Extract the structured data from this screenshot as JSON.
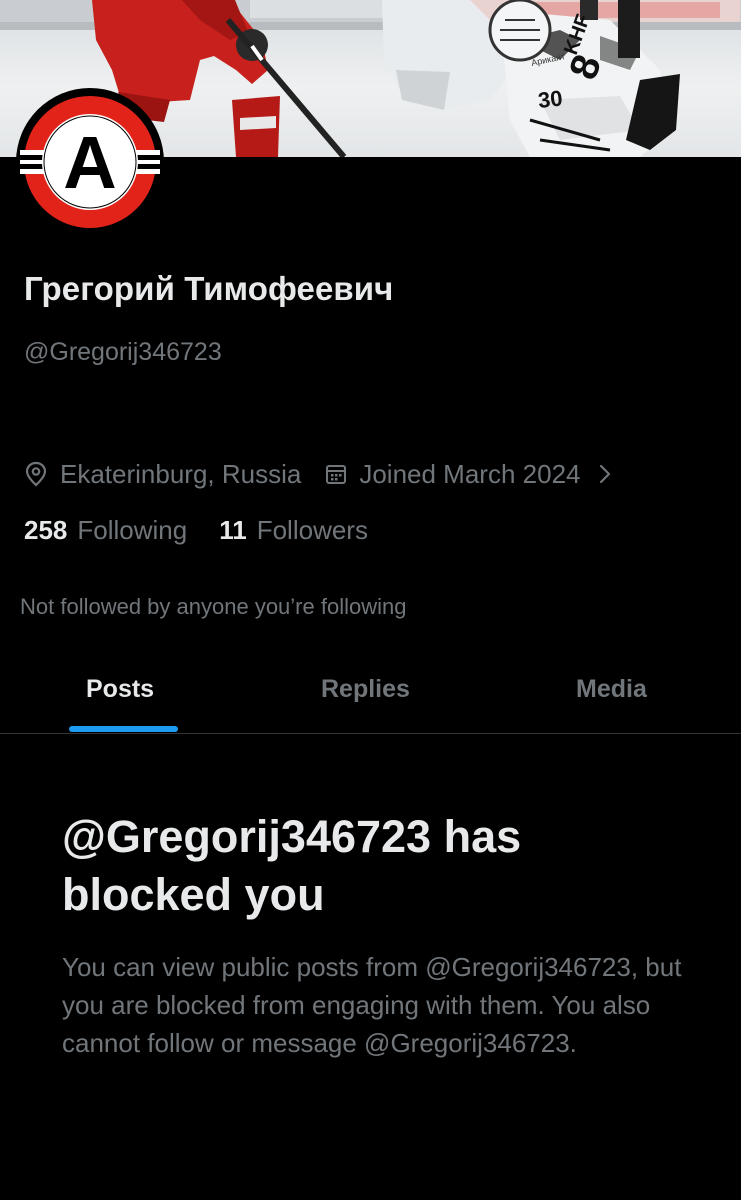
{
  "profile": {
    "display_name": "Грегорий Тимофеевич",
    "handle": "@Gregorij346723",
    "location": "Ekaterinburg, Russia",
    "joined": "Joined March 2024",
    "following_count": "258",
    "following_label": "Following",
    "followers_count": "11",
    "followers_label": "Followers",
    "followed_by_text": "Not followed by anyone you’re following",
    "avatar_letter": "A"
  },
  "banner": {
    "jersey_number_a": "30",
    "jersey_number_b": "8",
    "jersey_text": "KHF",
    "sponsor": "Арикант"
  },
  "tabs": [
    {
      "label": "Posts",
      "active": true
    },
    {
      "label": "Replies",
      "active": false
    },
    {
      "label": "Media",
      "active": false
    }
  ],
  "blocked": {
    "title": "@Gregorij346723 has blocked you",
    "description": "You can view public posts from @Gregorij346723, but you are blocked from engaging with them. You also cannot follow or message @Gregorij346723."
  },
  "colors": {
    "background": "#000000",
    "primary_text": "#e7e9ea",
    "secondary_text": "#71767b",
    "accent": "#1d9bf0",
    "avatar_red": "#e2231a"
  },
  "icons": [
    "location-pin-icon",
    "calendar-icon",
    "chevron-right-icon"
  ]
}
